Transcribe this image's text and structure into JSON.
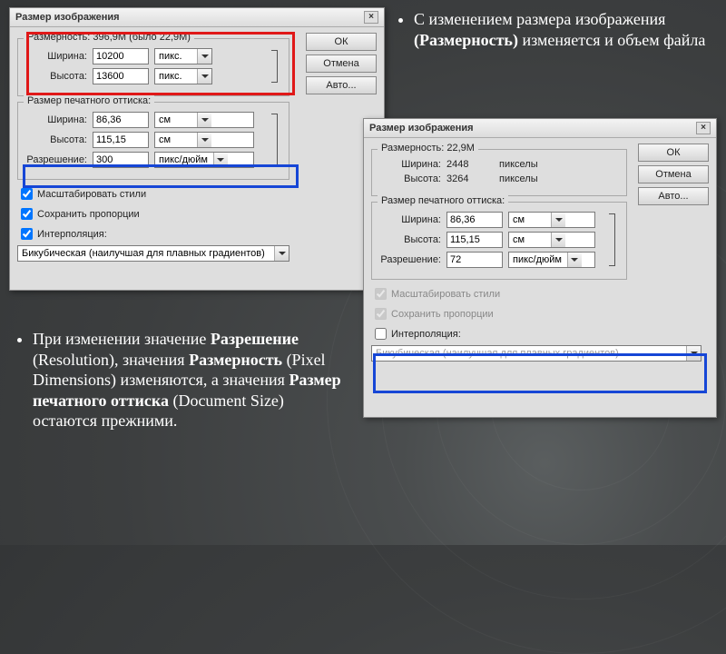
{
  "dlg1": {
    "title": "Размер изображения",
    "close": "×",
    "group_dim_title": "Размерность:   396,9М (было 22,9М)",
    "width_lbl": "Ширина:",
    "width_val": "10200",
    "unit_px": "пикс.",
    "height_lbl": "Высота:",
    "height_val": "13600",
    "group_doc_title": "Размер печатного оттиска:",
    "doc_w_lbl": "Ширина:",
    "doc_w_val": "86,36",
    "unit_cm": "см",
    "doc_h_lbl": "Высота:",
    "doc_h_val": "115,15",
    "res_lbl": "Разрешение:",
    "res_val": "300",
    "unit_ppi": "пикс/дюйм",
    "chk_scale": "Масштабировать стили",
    "chk_constrain": "Сохранить пропорции",
    "chk_interp": "Интерполяция:",
    "interp_method": "Бикубическая (наилучшая для плавных градиентов)",
    "btn_ok": "ОК",
    "btn_cancel": "Отмена",
    "btn_auto": "Авто..."
  },
  "dlg2": {
    "title": "Размер изображения",
    "close": "×",
    "group_dim_title": "Размерность:   22,9М",
    "width_lbl": "Ширина:",
    "width_val": "2448",
    "unit_px": "пикселы",
    "height_lbl": "Высота:",
    "height_val": "3264",
    "group_doc_title": "Размер печатного оттиска:",
    "doc_w_lbl": "Ширина:",
    "doc_w_val": "86,36",
    "unit_cm": "см",
    "doc_h_lbl": "Высота:",
    "doc_h_val": "115,15",
    "res_lbl": "Разрешение:",
    "res_val": "72",
    "unit_ppi": "пикс/дюйм",
    "chk_scale": "Масштабировать стили",
    "chk_constrain": "Сохранить пропорции",
    "chk_interp": "Интерполяция:",
    "interp_method": "Бикубическая (наилучшая для плавных градиентов)",
    "btn_ok": "ОК",
    "btn_cancel": "Отмена",
    "btn_auto": "Авто..."
  },
  "note1": "С изменением размера изображения <b>(Размерность)</b> изменяется и объем файла",
  "note2": "При изменении значение <b>Разрешение</b> (Resolution), значения <b>Размерность</b> (Pixel Dimensions) изменяются, а значения <b>Размер печатного оттиска</b> (Document Size) остаются прежними."
}
